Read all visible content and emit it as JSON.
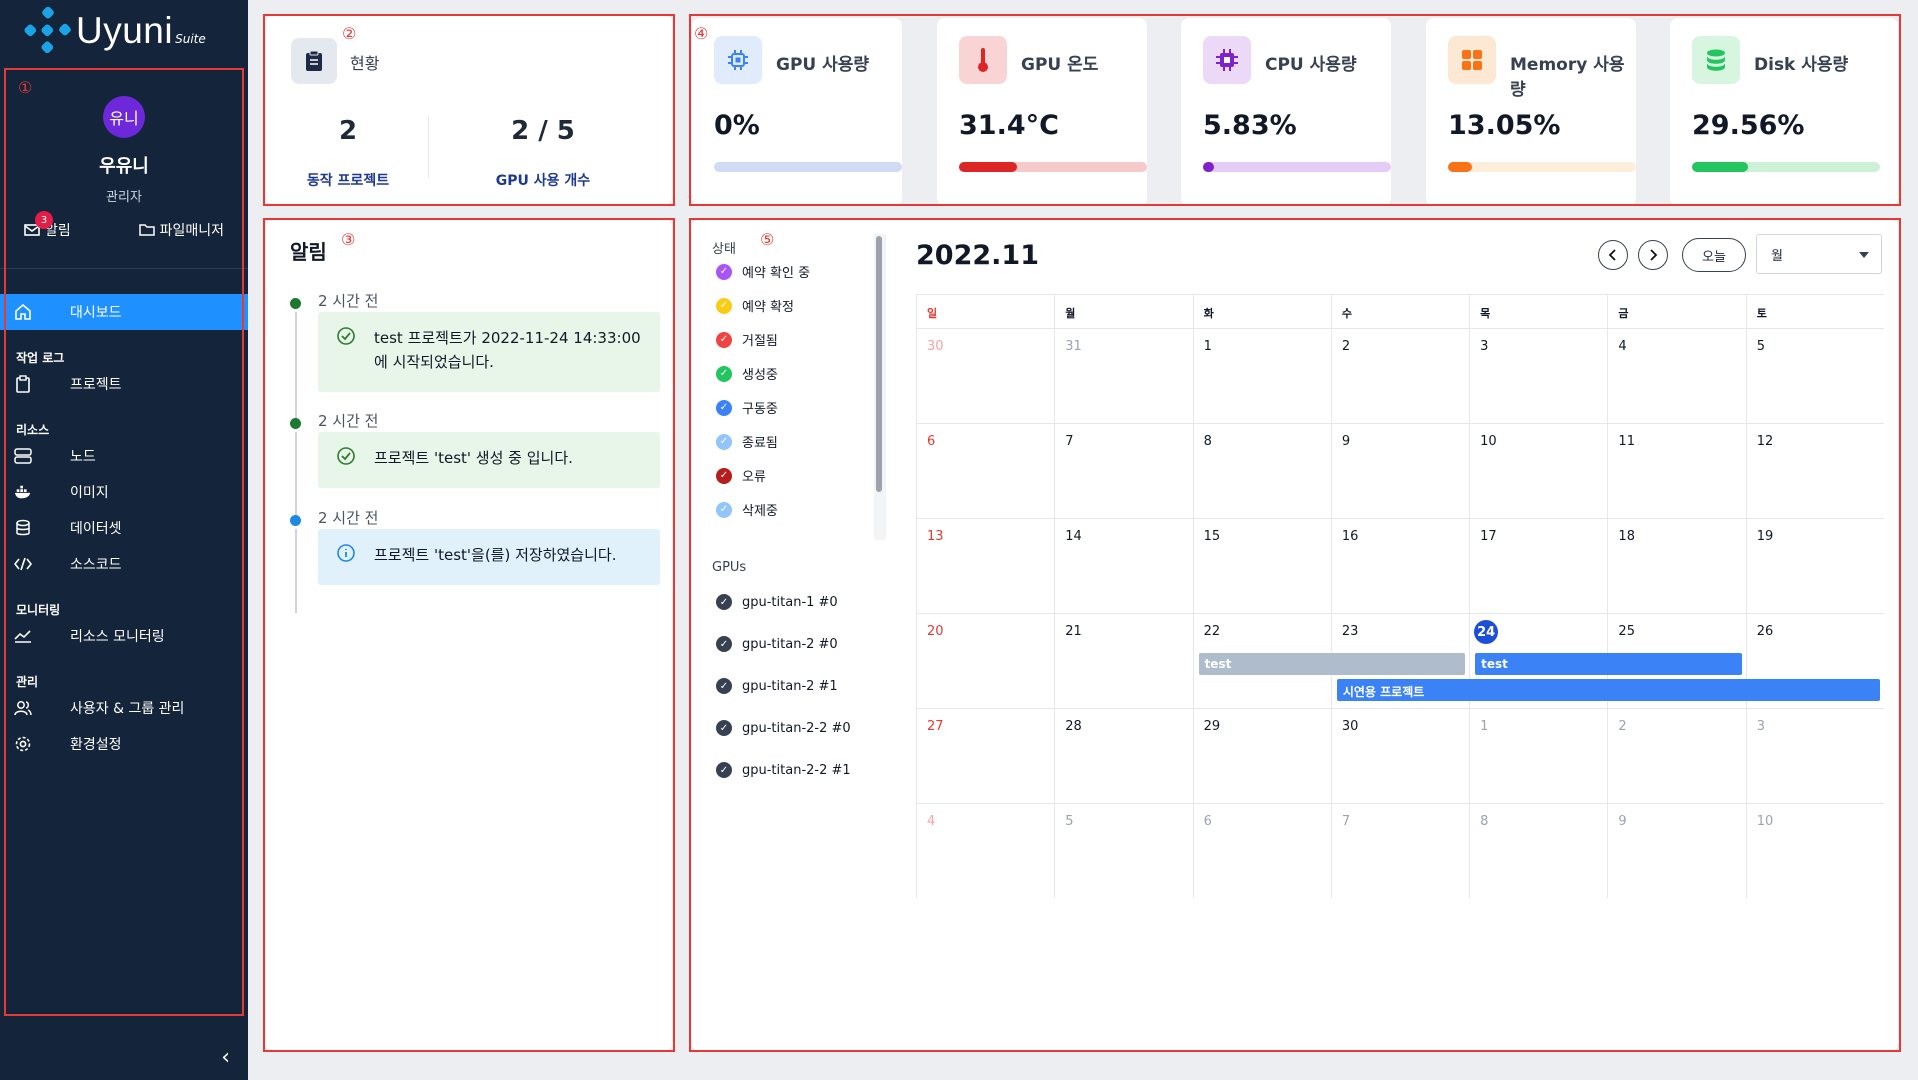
{
  "brand": {
    "name": "Uyuni",
    "suite": "Suite"
  },
  "user": {
    "avatar_text": "유니",
    "name": "우유니",
    "role": "관리자"
  },
  "quick": {
    "alerts_label": "알림",
    "alerts_count": "3",
    "files_label": "파일매니저"
  },
  "nav": {
    "dashboard": "대시보드",
    "section_log": "작업 로그",
    "project": "프로젝트",
    "section_resource": "리소스",
    "node": "노드",
    "image": "이미지",
    "dataset": "데이터셋",
    "source": "소스코드",
    "section_monitor": "모니터링",
    "resource_monitor": "리소스 모니터링",
    "section_admin": "관리",
    "users": "사용자 & 그룹 관리",
    "settings": "환경설정"
  },
  "markers": [
    "①",
    "②",
    "③",
    "④",
    "⑤"
  ],
  "status": {
    "title": "현황",
    "running_projects": "2",
    "running_projects_label": "동작 프로젝트",
    "gpu_usage": "2 / 5",
    "gpu_usage_label": "GPU 사용 개수"
  },
  "metrics": [
    {
      "title": "GPU 사용량",
      "value": "0%",
      "level": 0,
      "icon": "chip-icon",
      "color": "#3b82f6",
      "bg": "#e0ebfb",
      "track": "#cfdcf3"
    },
    {
      "title": "GPU 온도",
      "value": "31.4°C",
      "level": 0.31,
      "icon": "thermometer-icon",
      "color": "#dc2626",
      "bg": "#f8d4d4",
      "track": "#f6caca"
    },
    {
      "title": "CPU 사용량",
      "value": "5.83%",
      "level": 0.058,
      "icon": "cpu-icon",
      "color": "#7e22ce",
      "bg": "#ecd9f8",
      "track": "#e5ccf6"
    },
    {
      "title": "Memory 사용량",
      "value": "13.05%",
      "level": 0.13,
      "icon": "memory-icon",
      "color": "#f97316",
      "bg": "#fde8d3",
      "track": "#fdeedc"
    },
    {
      "title": "Disk 사용량",
      "value": "29.56%",
      "level": 0.2956,
      "icon": "disk-icon",
      "color": "#22c55e",
      "bg": "#d7f5df",
      "track": "#cdf1d7"
    }
  ],
  "alerts": {
    "title": "알림",
    "items": [
      {
        "time": "2 시간 전",
        "text": "test 프로젝트가 2022-11-24 14:33:00 에 시작되었습니다.",
        "kind": "success"
      },
      {
        "time": "2 시간 전",
        "text": "프로젝트 'test' 생성 중 입니다.",
        "kind": "success"
      },
      {
        "time": "2 시간 전",
        "text": "프로젝트 'test'을(를) 저장하였습니다.",
        "kind": "info"
      }
    ]
  },
  "calendar": {
    "title": "2022.11",
    "today_label": "오늘",
    "view": "월",
    "status_title": "상태",
    "statuses": [
      {
        "label": "예약 확인 중",
        "color": "#a855f7"
      },
      {
        "label": "예약 확정",
        "color": "#facc15"
      },
      {
        "label": "거절됨",
        "color": "#ef4444"
      },
      {
        "label": "생성중",
        "color": "#22c55e"
      },
      {
        "label": "구동중",
        "color": "#3b82f6"
      },
      {
        "label": "종료됨",
        "color": "#93c5fd"
      },
      {
        "label": "오류",
        "color": "#b91c1c"
      },
      {
        "label": "삭제중",
        "color": "#93c5fd"
      }
    ],
    "gpus_title": "GPUs",
    "gpus": [
      "gpu-titan-1 #0",
      "gpu-titan-2 #0",
      "gpu-titan-2 #1",
      "gpu-titan-2-2 #0",
      "gpu-titan-2-2 #1"
    ],
    "weekdays": [
      "일",
      "월",
      "화",
      "수",
      "목",
      "금",
      "토"
    ],
    "weeks": [
      [
        "30",
        "31",
        "1",
        "2",
        "3",
        "4",
        "5"
      ],
      [
        "6",
        "7",
        "8",
        "9",
        "10",
        "11",
        "12"
      ],
      [
        "13",
        "14",
        "15",
        "16",
        "17",
        "18",
        "19"
      ],
      [
        "20",
        "21",
        "22",
        "23",
        "24",
        "25",
        "26"
      ],
      [
        "27",
        "28",
        "29",
        "30",
        "1",
        "2",
        "3"
      ],
      [
        "4",
        "5",
        "6",
        "7",
        "8",
        "9",
        "10"
      ]
    ],
    "today": "24",
    "events": [
      {
        "label": "test",
        "start": 22,
        "end": 23,
        "color": "#aebccc"
      },
      {
        "label": "test",
        "start": 24,
        "end": 25,
        "color": "#3b82f6"
      },
      {
        "label": "시연용 프로젝트",
        "start": 23,
        "end": 26,
        "color": "#3b82f6"
      }
    ]
  }
}
